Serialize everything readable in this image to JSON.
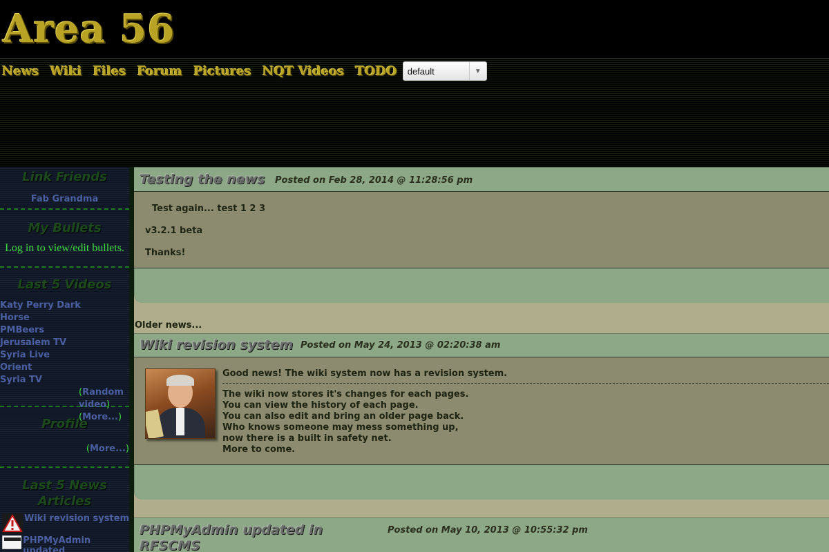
{
  "site": {
    "title": "Area 56"
  },
  "nav": {
    "links": [
      "News",
      "Wiki",
      "Files",
      "Forum",
      "Pictures",
      "NQT Videos",
      "TODO"
    ],
    "theme_select": {
      "value": "default"
    }
  },
  "sidebar": {
    "link_friends": {
      "title": "Link Friends",
      "links": [
        "Fab Grandma"
      ]
    },
    "my_bullets": {
      "title": "My Bullets",
      "text": "Log in to view/edit bullets."
    },
    "last_videos": {
      "title": "Last 5 Videos",
      "videos": [
        "Katy Perry Dark Horse",
        "PMBeers",
        "Jerusalem TV",
        "Syria Live Orient",
        "Syria TV"
      ],
      "random_link": "Random video",
      "more_link": "More..."
    },
    "profile": {
      "title": "Profile",
      "more_link": "More..."
    },
    "last_news": {
      "title": "Last 5 News Articles",
      "items": [
        "Wiki revision system",
        "PHPMyAdmin updated"
      ]
    }
  },
  "posts": [
    {
      "title": "Testing the news",
      "date": "Posted on Feb 28, 2014 @ 11:28:56 pm",
      "lines": [
        "Test again... test 1 2 3",
        "v3.2.1 beta",
        "Thanks!"
      ]
    },
    {
      "title": "Wiki revision system",
      "date": "Posted on May 24, 2013 @ 02:20:38 am",
      "intro": "Good news! The wiki system now has a revision system.",
      "lines": [
        "The wiki now stores it's changes for each pages.",
        "You can view the history of each page.",
        "You can also edit and bring an older page back.",
        "Who knows someone may mess something up,",
        "now there is a built in safety net.",
        "More to come."
      ]
    },
    {
      "title": "PHPMyAdmin updated in RFSCMS",
      "date": "Posted on May 10, 2013 @ 10:55:32 pm"
    }
  ],
  "older_news_label": "Older news..."
}
